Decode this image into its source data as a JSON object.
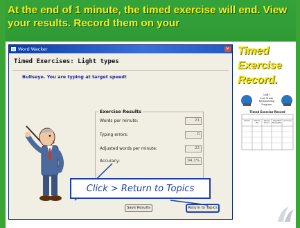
{
  "slide": {
    "headline": "At the end of 1 minute, the timed exercise will end.  View your results.  Record them on your",
    "headline_right": "Timed Exercise Record.",
    "colors": {
      "green": "#3aa435",
      "yellow": "#f4f019",
      "blue": "#1e3fa8"
    }
  },
  "window": {
    "title": "Word Wacker",
    "screen_title": "Timed Exercises: Light types",
    "status": "Bullseye.  You are typing at target speed!",
    "results": {
      "title": "Exercise Results",
      "rows": [
        {
          "label": "Words per minute:",
          "value": "21"
        },
        {
          "label": "Typing errors:",
          "value": "0"
        },
        {
          "label": "Adjusted words per minute:",
          "value": "22"
        },
        {
          "label": "Accuracy:",
          "value": "94.1%"
        }
      ]
    },
    "buttons": {
      "save": "Save Results",
      "topics": "Return to Topics"
    }
  },
  "callout": {
    "text": "Click > Return to Topics"
  },
  "record_card": {
    "header_line1": "LBBT",
    "header_line2": "2nd Grade",
    "header_line3": "Keyboarding",
    "header_line4": "Program",
    "title": "Timed Exercise Record",
    "columns": [
      "Lesson",
      "Words/ Min",
      "Typing Errors",
      "Adjusted Words/Min",
      "Accuracy"
    ]
  }
}
